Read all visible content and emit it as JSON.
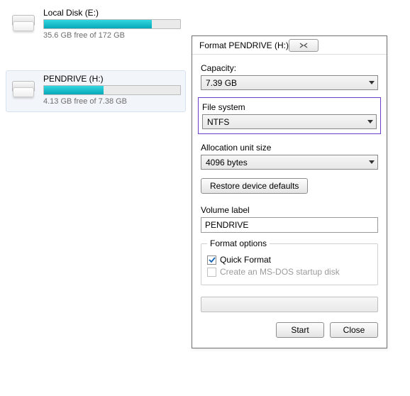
{
  "drives": [
    {
      "name": "Local Disk (E:)",
      "progress_pct": 79,
      "free_text": "35.6 GB free of 172 GB",
      "selected": false
    },
    {
      "name": "PENDRIVE (H:)",
      "progress_pct": 44,
      "free_text": "4.13 GB free of 7.38 GB",
      "selected": true
    }
  ],
  "dialog": {
    "title": "Format PENDRIVE (H:)",
    "capacity_label": "Capacity:",
    "capacity_value": "7.39 GB",
    "fs_label": "File system",
    "fs_value": "NTFS",
    "aus_label": "Allocation unit size",
    "aus_value": "4096 bytes",
    "restore_btn": "Restore device defaults",
    "volume_label_label": "Volume label",
    "volume_label_value": "PENDRIVE",
    "options_legend": "Format options",
    "quick_format": "Quick Format",
    "quick_format_checked": true,
    "msdos": "Create an MS-DOS startup disk",
    "msdos_checked": false,
    "msdos_enabled": false,
    "start_btn": "Start",
    "close_btn": "Close"
  }
}
